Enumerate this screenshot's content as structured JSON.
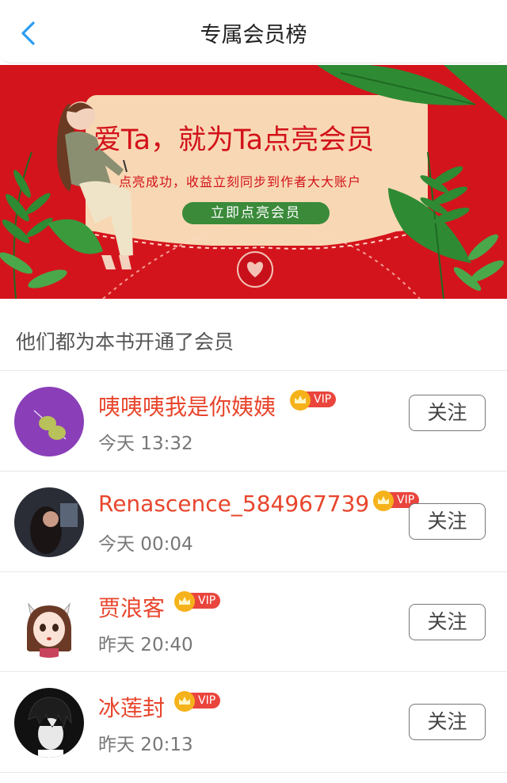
{
  "header": {
    "title": "专属会员榜"
  },
  "banner": {
    "headline": "爱Ta，就为Ta点亮会员",
    "subtitle": "点亮成功，收益立刻同步到作者大大账户",
    "cta_label": "立即点亮会员"
  },
  "section": {
    "title": "他们都为本书开通了会员"
  },
  "members": [
    {
      "name": "咦咦咦我是你姨姨",
      "badge": "VIP",
      "time": "今天 13:32",
      "follow_label": "关注"
    },
    {
      "name": "Renascence_584967739",
      "badge": "VIP",
      "time": "今天 00:04",
      "follow_label": "关注"
    },
    {
      "name": "贾浪客",
      "badge": "VIP",
      "time": "昨天 20:40",
      "follow_label": "关注"
    },
    {
      "name": "冰莲封",
      "badge": "VIP",
      "time": "昨天 20:13",
      "follow_label": "关注"
    }
  ],
  "colors": {
    "accent_red": "#e8452c",
    "banner_red": "#d4141c",
    "back_arrow_blue": "#2a9df4",
    "vip_gold": "#f6b21a",
    "cta_green": "#3a8a3a"
  },
  "icons": {
    "back": "chevron-left-icon",
    "crown": "crown-icon"
  }
}
